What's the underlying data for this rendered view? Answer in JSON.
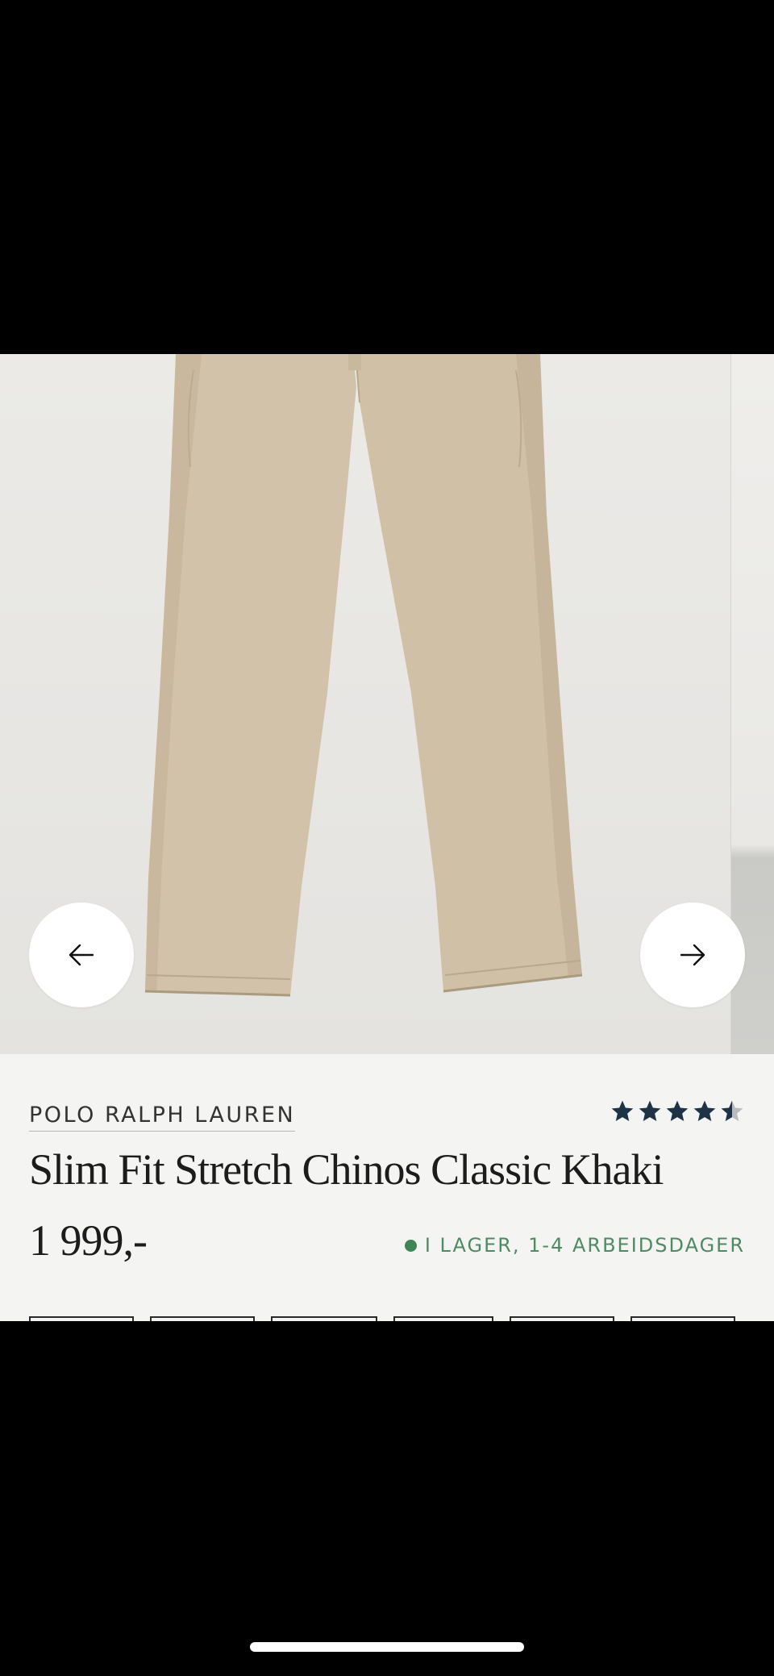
{
  "product": {
    "brand": "POLO RALPH LAUREN",
    "title": "Slim Fit Stretch Chinos Classic Khaki",
    "price": "1 999,-",
    "stock_status": "I LAGER, 1-4 ARBEIDSDAGER",
    "rating": 4.5,
    "rating_max": 5
  },
  "gallery": {
    "prev_icon": "arrow-left-icon",
    "next_icon": "arrow-right-icon"
  },
  "size_options_visible": 6,
  "colors": {
    "info_background": "#f4f4f2",
    "star_color": "#1e3446",
    "stock_green": "#4e8a62",
    "product_khaki": "#d2c2a9"
  }
}
